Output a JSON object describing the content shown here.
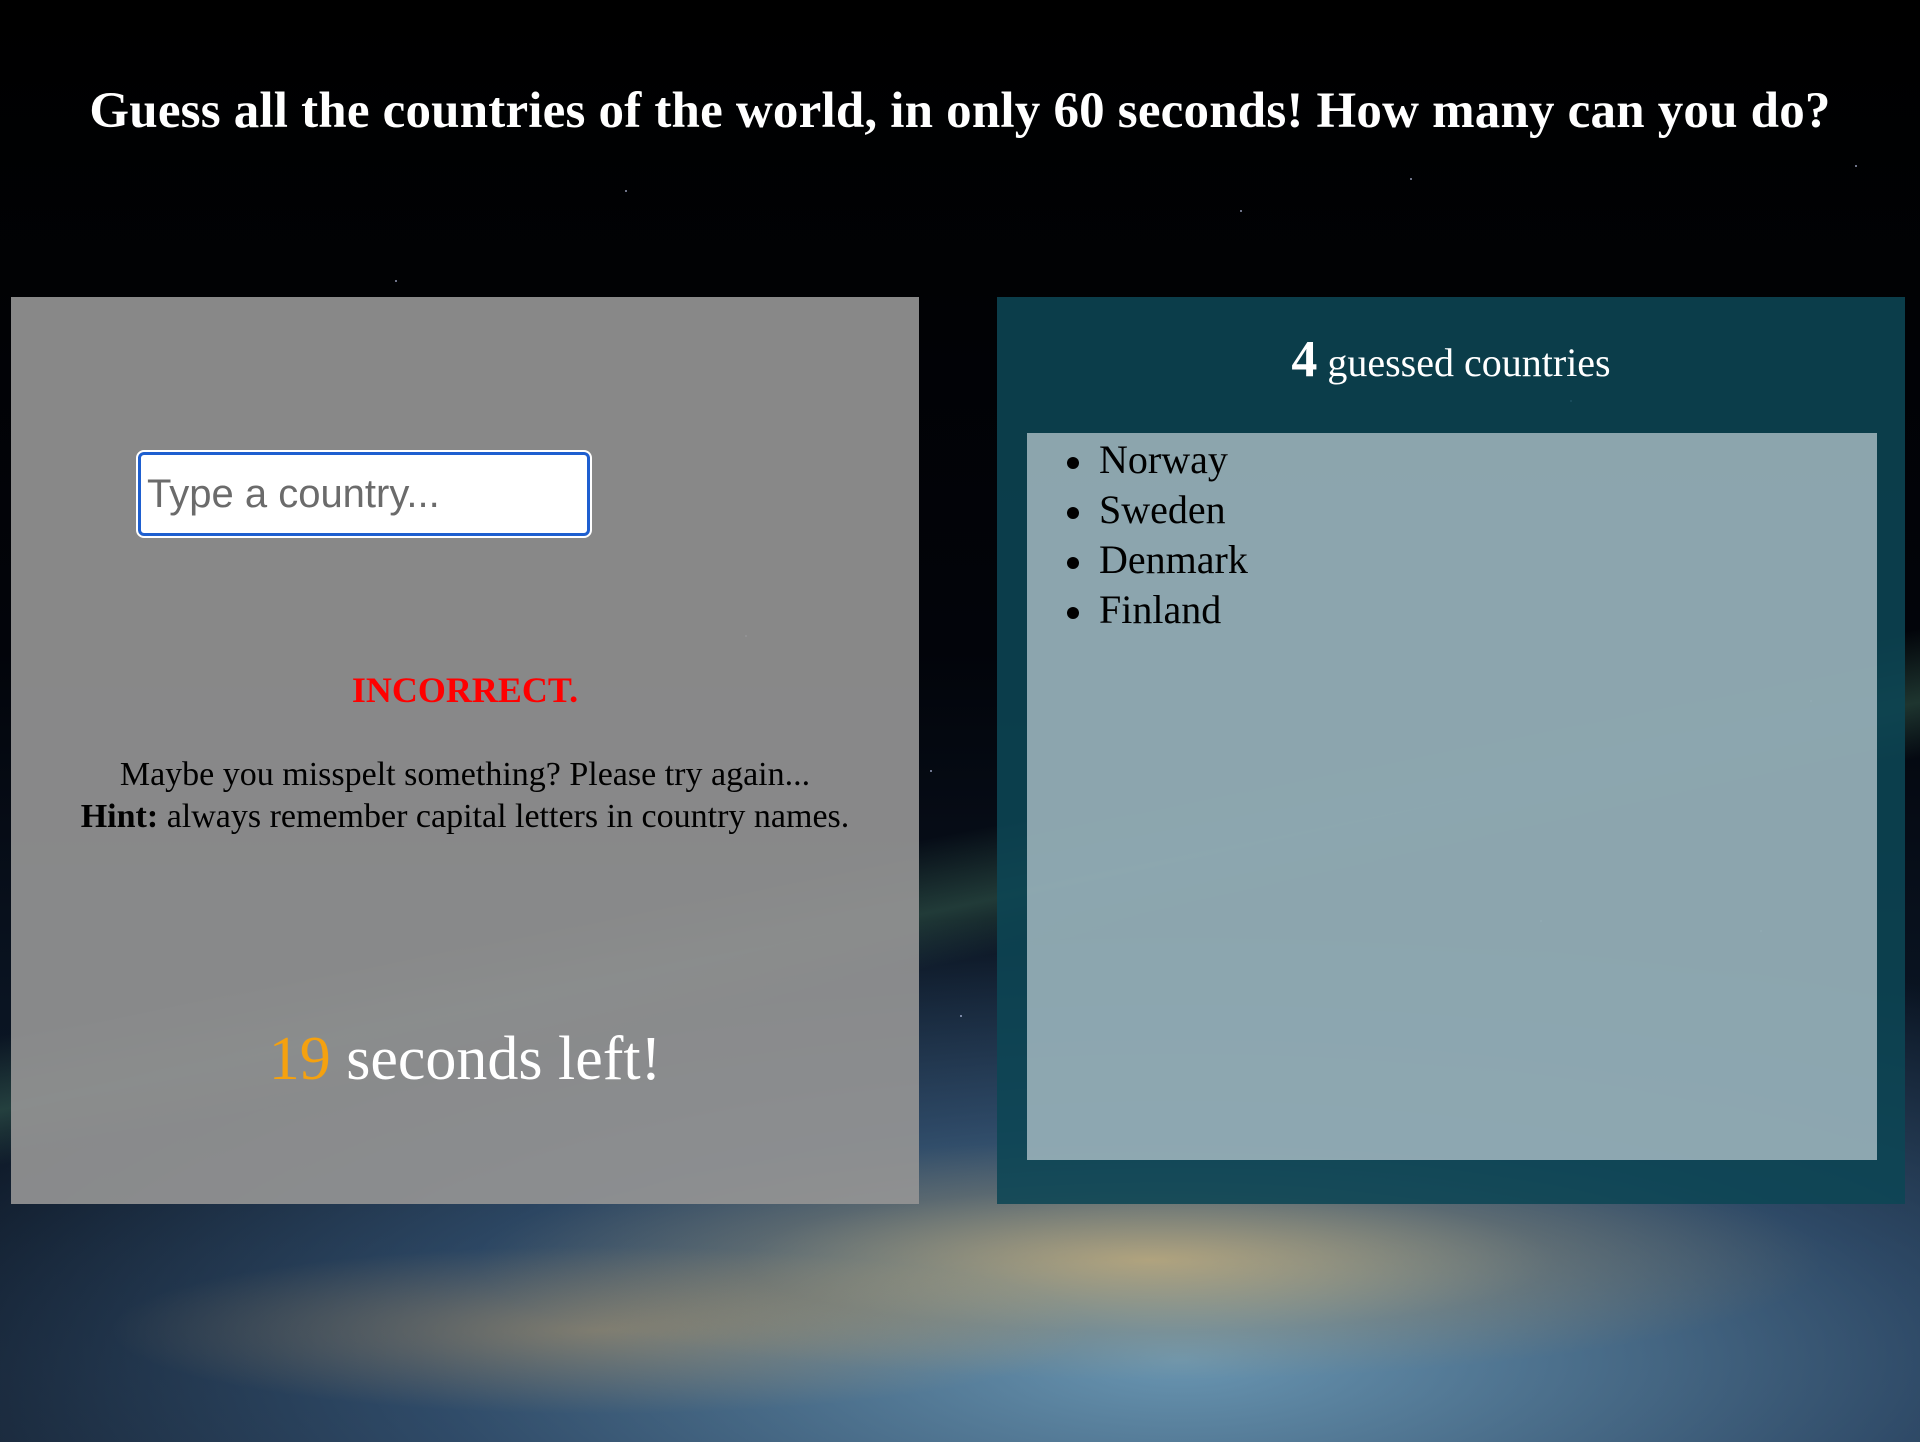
{
  "page": {
    "title": "Guess all the countries of the world, in only 60 seconds! How many can you do?"
  },
  "game": {
    "input_placeholder": "Type a country...",
    "input_value": "",
    "feedback_status": "INCORRECT.",
    "feedback_message": "Maybe you misspelt something? Please try again...",
    "hint_label": "Hint:",
    "hint_text": "always remember capital letters in country names.",
    "seconds_left": "19",
    "seconds_suffix": "seconds left!"
  },
  "results": {
    "count": "4",
    "count_label": "guessed countries",
    "countries": [
      "Norway",
      "Sweden",
      "Denmark",
      "Finland"
    ]
  },
  "colors": {
    "incorrect": "#ff0000",
    "timer_number": "#f5a10f",
    "input_border": "#1e5fd0"
  }
}
